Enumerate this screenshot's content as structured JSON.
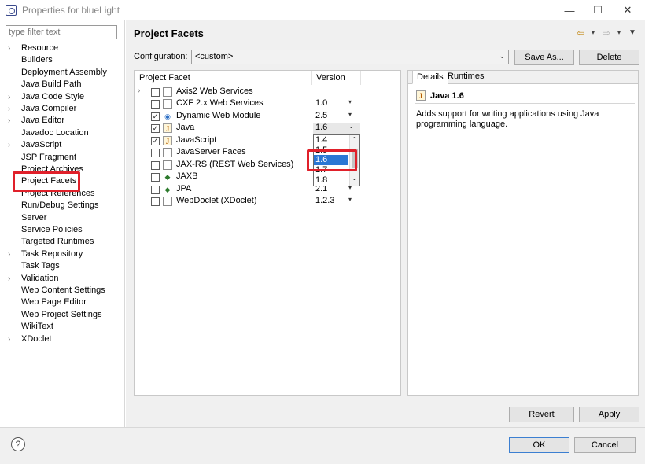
{
  "window": {
    "title": "Properties for blueLight",
    "controls": [
      "minimize",
      "maximize",
      "close"
    ]
  },
  "filter": {
    "placeholder": "type filter text"
  },
  "nav": [
    {
      "label": "Resource",
      "expandable": true
    },
    {
      "label": "Builders",
      "expandable": false
    },
    {
      "label": "Deployment Assembly",
      "expandable": false
    },
    {
      "label": "Java Build Path",
      "expandable": false
    },
    {
      "label": "Java Code Style",
      "expandable": true
    },
    {
      "label": "Java Compiler",
      "expandable": true
    },
    {
      "label": "Java Editor",
      "expandable": true
    },
    {
      "label": "Javadoc Location",
      "expandable": false
    },
    {
      "label": "JavaScript",
      "expandable": true
    },
    {
      "label": "JSP Fragment",
      "expandable": false
    },
    {
      "label": "Project Archives",
      "expandable": false
    },
    {
      "label": "Project Facets",
      "expandable": false,
      "selected": true
    },
    {
      "label": "Project References",
      "expandable": false
    },
    {
      "label": "Run/Debug Settings",
      "expandable": false
    },
    {
      "label": "Server",
      "expandable": false
    },
    {
      "label": "Service Policies",
      "expandable": false
    },
    {
      "label": "Targeted Runtimes",
      "expandable": false
    },
    {
      "label": "Task Repository",
      "expandable": true
    },
    {
      "label": "Task Tags",
      "expandable": false
    },
    {
      "label": "Validation",
      "expandable": true
    },
    {
      "label": "Web Content Settings",
      "expandable": false
    },
    {
      "label": "Web Page Editor",
      "expandable": false
    },
    {
      "label": "Web Project Settings",
      "expandable": false
    },
    {
      "label": "WikiText",
      "expandable": false
    },
    {
      "label": "XDoclet",
      "expandable": true
    }
  ],
  "page": {
    "title": "Project Facets",
    "configuration_label": "Configuration:",
    "configuration_value": "<custom>",
    "save_as": "Save As...",
    "delete": "Delete"
  },
  "table": {
    "col_facet": "Project Facet",
    "col_version": "Version",
    "rows": [
      {
        "name": "Axis2 Web Services",
        "checked": false,
        "version": "",
        "icon": "page-icon",
        "twisty": true
      },
      {
        "name": "CXF 2.x Web Services",
        "checked": false,
        "version": "1.0",
        "icon": "page-icon",
        "twisty": false
      },
      {
        "name": "Dynamic Web Module",
        "checked": true,
        "version": "2.5",
        "icon": "web-module-icon",
        "twisty": false
      },
      {
        "name": "Java",
        "checked": true,
        "version": "1.6",
        "icon": "java-icon",
        "twisty": false
      },
      {
        "name": "JavaScript",
        "checked": true,
        "version": "",
        "icon": "javascript-icon",
        "twisty": false
      },
      {
        "name": "JavaServer Faces",
        "checked": false,
        "version": "",
        "icon": "page-icon",
        "twisty": false
      },
      {
        "name": "JAX-RS (REST Web Services)",
        "checked": false,
        "version": "",
        "icon": "page-icon",
        "twisty": false
      },
      {
        "name": "JAXB",
        "checked": false,
        "version": "",
        "icon": "jaxb-icon",
        "twisty": false
      },
      {
        "name": "JPA",
        "checked": false,
        "version": "2.1",
        "icon": "jpa-icon",
        "twisty": false
      },
      {
        "name": "WebDoclet (XDoclet)",
        "checked": false,
        "version": "1.2.3",
        "icon": "page-icon",
        "twisty": false
      }
    ]
  },
  "version_dropdown": {
    "options": [
      "1.4",
      "1.5",
      "1.6",
      "1.7",
      "1.8"
    ],
    "selected": "1.6"
  },
  "details": {
    "tab_details": "Details",
    "tab_runtimes": "Runtimes",
    "title": "Java 1.6",
    "description": "Adds support for writing applications using Java programming language."
  },
  "buttons": {
    "revert": "Revert",
    "apply": "Apply",
    "ok": "OK",
    "cancel": "Cancel",
    "help": "?"
  }
}
